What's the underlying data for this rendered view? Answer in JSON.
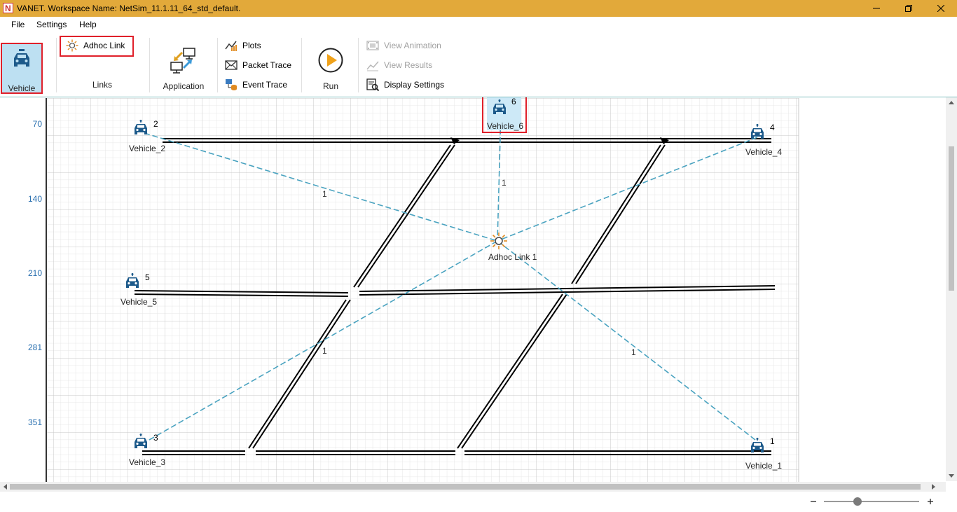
{
  "window": {
    "title": "VANET. Workspace Name: NetSim_11.1.11_64_std_default.",
    "app_icon_letter": "N",
    "accent_color": "#e2a93a"
  },
  "menu": {
    "items": [
      "File",
      "Settings",
      "Help"
    ]
  },
  "ribbon": {
    "vehicle_label": "Vehicle",
    "adhoc_link_label": "Adhoc Link",
    "links_group_label": "Links",
    "application_label": "Application",
    "plots_label": "Plots",
    "packet_trace_label": "Packet Trace",
    "event_trace_label": "Event Trace",
    "run_label": "Run",
    "view_animation_label": "View Animation",
    "view_results_label": "View Results",
    "display_settings_label": "Display Settings"
  },
  "canvas": {
    "y_ticks": [
      "70",
      "140",
      "210",
      "281",
      "351"
    ],
    "vehicles": [
      {
        "id": "1",
        "name": "Vehicle_1"
      },
      {
        "id": "2",
        "name": "Vehicle_2"
      },
      {
        "id": "3",
        "name": "Vehicle_3"
      },
      {
        "id": "4",
        "name": "Vehicle_4"
      },
      {
        "id": "5",
        "name": "Vehicle_5"
      },
      {
        "id": "6",
        "name": "Vehicle_6"
      }
    ],
    "adhoc_link_name": "Adhoc Link 1",
    "link_label": "1",
    "road_color": "#000000",
    "link_color": "#4aa3c0",
    "highlight_color": "#e0202a"
  },
  "icons": {
    "vehicle": "car-icon",
    "adhoc_link": "adhoc-link-icon",
    "application": "application-icon",
    "run": "run-icon"
  }
}
